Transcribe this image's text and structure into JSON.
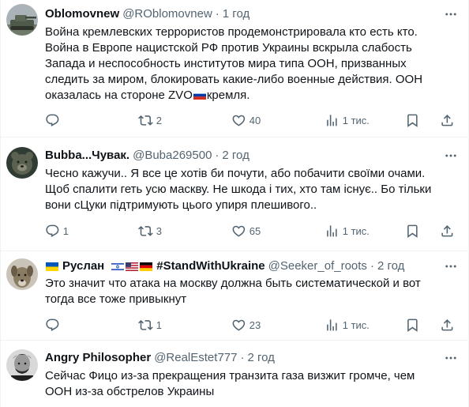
{
  "tweets": [
    {
      "name": "Oblomovnew",
      "handle": "@ROblomovnew",
      "separator": "·",
      "time": "1 год",
      "text_before_flag": "Война кремлевских террористов продемонстрировала кто есть кто.\nВойна в Европе нацистской РФ против Украины вскрыла слабость Запада и неспособность институтов мира типа ООН, призванных следить за миром, блокировать какие-либо военные действия. ООН оказалась на стороне ZVO",
      "text_after_flag": "кремля.",
      "avatar": "tank-avatar",
      "replies": "",
      "reposts": "2",
      "likes": "40",
      "views": "1 тис."
    },
    {
      "name": "Bubba...Чувак.",
      "handle": "@Buba269500",
      "separator": "·",
      "time": "2 год",
      "text": "Чесно кажучи.. Я все це хотів би почути, або побачити своїми очами. Щоб спалити геть усю маскву. Не шкода і тих, хто там існує.. Бо тільки вони сЦуки підтримують цього упиря плешивого..",
      "avatar": "bear-avatar",
      "replies": "1",
      "reposts": "3",
      "likes": "65",
      "views": "1 тис."
    },
    {
      "name_prefix": "Руслан",
      "name_suffix": "#StandWithUkraine",
      "handle": "@Seeker_of_roots",
      "separator": "·",
      "time": "2 год",
      "text": "Это значит что атака на москву должна быть систематической и вот тогда все тоже привыкнут",
      "avatar": "dog-avatar",
      "replies": "",
      "reposts": "1",
      "likes": "23",
      "views": "1 тис."
    },
    {
      "name": "Angry Philosopher",
      "handle": "@RealEstet777",
      "separator": "·",
      "time": "2 год",
      "text": "Сейчас Фицо из-за прекращения транзита газа визжит громче, чем ООН из-за обстрелов Украины",
      "avatar": "philosopher-avatar"
    }
  ],
  "icons": {
    "reply": "reply-icon",
    "repost": "repost-icon",
    "like": "like-icon",
    "views": "views-icon",
    "bookmark": "bookmark-icon",
    "share": "share-icon",
    "more": "more-icon"
  },
  "colors": {
    "text": "#0f1419",
    "secondary": "#536471",
    "divider": "#eff3f4"
  }
}
